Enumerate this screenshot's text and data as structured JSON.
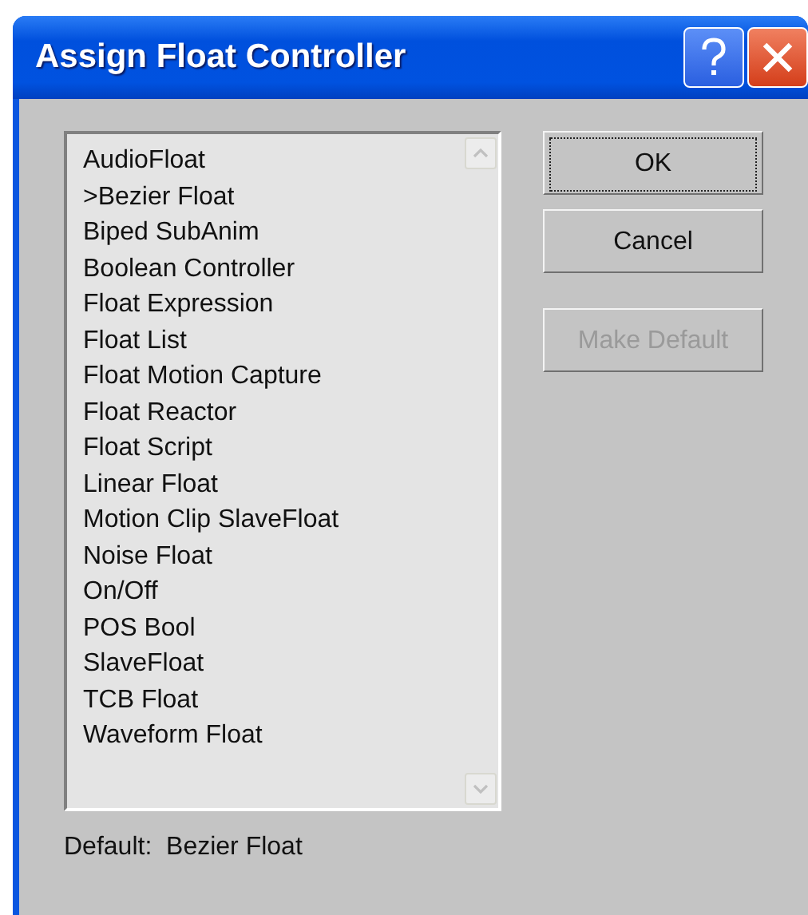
{
  "window": {
    "title": "Assign Float Controller"
  },
  "controllers": [
    "AudioFloat",
    ">Bezier Float",
    "Biped SubAnim",
    "Boolean Controller",
    "Float Expression",
    "Float List",
    "Float Motion Capture",
    "Float Reactor",
    "Float Script",
    "Linear Float",
    "Motion Clip SlaveFloat",
    "Noise Float",
    "On/Off",
    "POS Bool",
    "SlaveFloat",
    "TCB Float",
    "Waveform Float"
  ],
  "buttons": [
    {
      "label": "OK",
      "focused": true,
      "disabled": false
    },
    {
      "label": "Cancel",
      "focused": false,
      "disabled": false
    },
    {
      "label": "Make Default",
      "focused": false,
      "disabled": true
    }
  ],
  "default_label": "Default:  Bezier Float"
}
